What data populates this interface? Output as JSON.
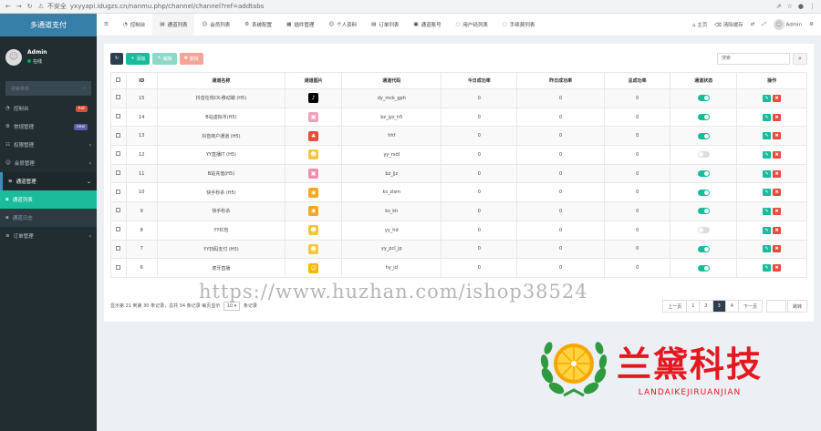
{
  "browser": {
    "security": "不安全",
    "url": "yxyyapi.idugzs.cn/nanmu.php/channel/channel?ref=addtabs"
  },
  "sidebar": {
    "title": "多通道支付",
    "user": {
      "name": "Admin",
      "status": "在线"
    },
    "search_placeholder": "搜索菜单",
    "items": [
      {
        "label": "控制台",
        "badge": "hot",
        "badge_color": "#dd4b39"
      },
      {
        "label": "常规管理",
        "badge": "new",
        "badge_color": "#605ca8"
      },
      {
        "label": "权限管理"
      },
      {
        "label": "会员管理"
      },
      {
        "label": "通道管理"
      },
      {
        "label": "通道列表"
      },
      {
        "label": "通道日志"
      },
      {
        "label": "订单管理"
      }
    ]
  },
  "topnav": {
    "tabs": [
      "控制台",
      "通道列表",
      "会员列表",
      "系统配置",
      "插件管理",
      "个人资料",
      "订单列表",
      "通道账号",
      "用户码列表",
      "手续费列表"
    ],
    "home": "主页",
    "clear_cache": "清除缓存",
    "admin": "Admin"
  },
  "toolbar": {
    "add": "添加",
    "edit": "编辑",
    "delete": "删除",
    "search_placeholder": "搜索"
  },
  "table": {
    "headers": [
      "ID",
      "通道名称",
      "通道图片",
      "通道代码",
      "今日成功率",
      "昨日成功率",
      "总成功率",
      "通道状态",
      "操作"
    ],
    "rows": [
      {
        "id": "15",
        "name": "抖音在线CK-移动端 (H5)",
        "code": "dy_mck_gph",
        "today": "0",
        "yesterday": "0",
        "total": "0",
        "status": "on",
        "img_color": "#000000",
        "img_glyph": "♪"
      },
      {
        "id": "14",
        "name": "B站虚拟币(H5)",
        "code": "bz_jyz_h5",
        "today": "0",
        "yesterday": "0",
        "total": "0",
        "status": "on",
        "img_color": "#f0a0b8",
        "img_glyph": "▣"
      },
      {
        "id": "13",
        "name": "抖音商户通道 (H5)",
        "code": "hhf",
        "today": "0",
        "yesterday": "0",
        "total": "0",
        "status": "on",
        "img_color": "#e74c3c",
        "img_glyph": "♣"
      },
      {
        "id": "12",
        "name": "YY直播IT (H5)",
        "code": "yy_rsdl",
        "today": "0",
        "yesterday": "0",
        "total": "0",
        "status": "off",
        "img_color": "#f4c542",
        "img_glyph": "☻"
      },
      {
        "id": "11",
        "name": "B站充值(H5)",
        "code": "bz_jjz",
        "today": "0",
        "yesterday": "0",
        "total": "0",
        "status": "on",
        "img_color": "#f08cb0",
        "img_glyph": "▣"
      },
      {
        "id": "10",
        "name": "快手秒杀 (H5)",
        "code": "ks_zlsm",
        "today": "0",
        "yesterday": "0",
        "total": "0",
        "status": "on",
        "img_color": "#f5a623",
        "img_glyph": "◉"
      },
      {
        "id": "9",
        "name": "快手秒杀",
        "code": "ks_kh",
        "today": "0",
        "yesterday": "0",
        "total": "0",
        "status": "on",
        "img_color": "#f5a623",
        "img_glyph": "◉"
      },
      {
        "id": "8",
        "name": "YY红包",
        "code": "yy_hd",
        "today": "0",
        "yesterday": "0",
        "total": "0",
        "status": "off",
        "img_color": "#f4c542",
        "img_glyph": "☻"
      },
      {
        "id": "7",
        "name": "YY扫码支付 (H5)",
        "code": "yy_pcl_jp",
        "today": "0",
        "yesterday": "0",
        "total": "0",
        "status": "on",
        "img_color": "#f4c542",
        "img_glyph": "☻"
      },
      {
        "id": "6",
        "name": "虎牙直播",
        "code": "hy_jd",
        "today": "0",
        "yesterday": "0",
        "total": "0",
        "status": "on",
        "img_color": "#f5b800",
        "img_glyph": "☺"
      }
    ]
  },
  "footer": {
    "summary_pre": "显示第 21 到第 30 条记录，总共 34 条记录 每页显示",
    "per_page": "10",
    "summary_post": "条记录",
    "pages": [
      "上一页",
      "1",
      "2",
      "3",
      "4",
      "下一页"
    ],
    "current": "3",
    "jump": "跳转"
  },
  "watermark": "https://www.huzhan.com/ishop38524",
  "brand": {
    "cn": "兰黛科技",
    "en": "LANDAIKEJIRUANJIAN"
  }
}
